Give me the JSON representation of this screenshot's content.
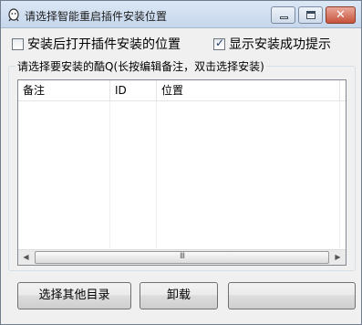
{
  "window": {
    "title": "请选择智能重启插件安装位置",
    "caption_buttons": {
      "minimize_icon": "minimize-icon",
      "maximize_icon": "maximize-icon",
      "close_icon": "close-icon"
    }
  },
  "options": {
    "open_location": {
      "label": "安装后打开插件安装的位置",
      "checked": false
    },
    "show_success": {
      "label": "显示安装成功提示",
      "checked": true
    }
  },
  "group": {
    "caption": "请选择要安装的酷Q(长按编辑备注，双击选择安装)"
  },
  "list": {
    "columns": [
      "备注",
      "ID",
      "位置"
    ],
    "rows": []
  },
  "scrollbar": {
    "thumb_grip": "III"
  },
  "buttons": {
    "other_dir": "选择其他目录",
    "uninstall": "卸载",
    "blank": ""
  }
}
